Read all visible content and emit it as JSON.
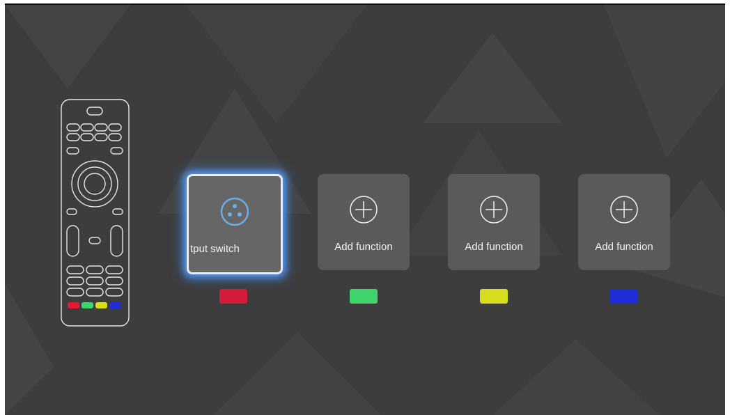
{
  "functions": [
    {
      "label": "tput switch",
      "icon": "speaker-connector-icon",
      "selected": true,
      "key_color": "#d21c3a"
    },
    {
      "label": "Add function",
      "icon": "add-circle-icon",
      "selected": false,
      "key_color": "#3fd36b"
    },
    {
      "label": "Add function",
      "icon": "add-circle-icon",
      "selected": false,
      "key_color": "#d5dd1e"
    },
    {
      "label": "Add function",
      "icon": "add-circle-icon",
      "selected": false,
      "key_color": "#1f2ed8"
    }
  ],
  "remote": {
    "color_keys": [
      "#e5192f",
      "#3fd36b",
      "#d5dd1e",
      "#1f2ed8"
    ]
  },
  "colors": {
    "background": "#3d3d3d",
    "card": "#5a5a5a",
    "focus_glow": "#5aa0ff",
    "icon_accent": "#6aaee8"
  }
}
